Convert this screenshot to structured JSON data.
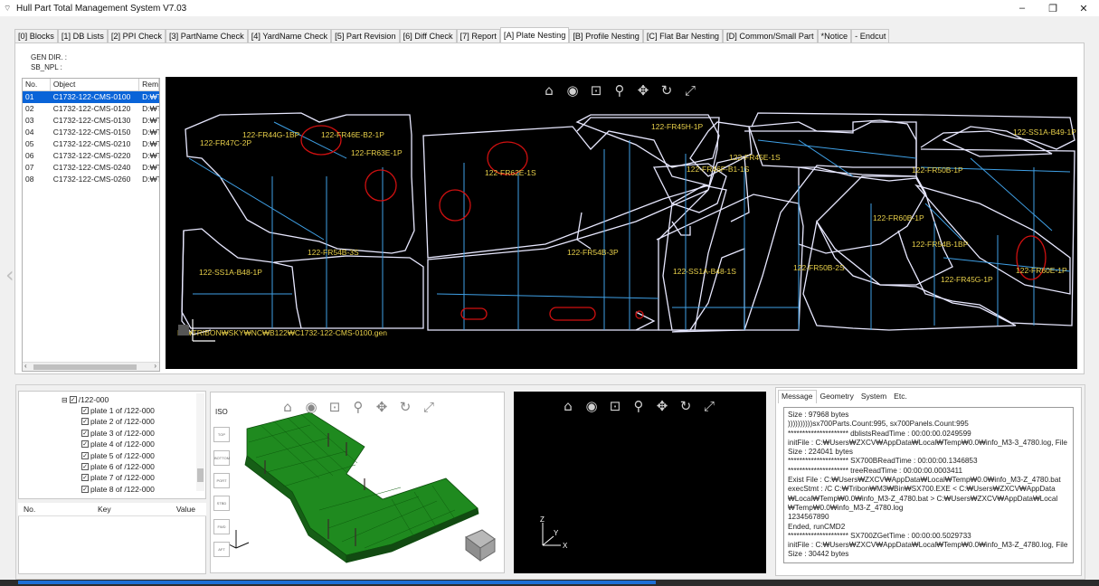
{
  "window": {
    "title": "Hull Part Total Management System V7.03",
    "controls": [
      "–",
      "❐",
      "✕"
    ]
  },
  "tabs": [
    {
      "label": "[0] Blocks"
    },
    {
      "label": "[1] DB Lists"
    },
    {
      "label": "[2] PPI Check"
    },
    {
      "label": "[3] PartName Check"
    },
    {
      "label": "[4] YardName Check"
    },
    {
      "label": "[5] Part Revision"
    },
    {
      "label": "[6] Diff Check"
    },
    {
      "label": "[7] Report"
    },
    {
      "label": "[A] Plate Nesting",
      "active": true
    },
    {
      "label": "[B] Profile Nesting"
    },
    {
      "label": "[C] Flat Bar Nesting"
    },
    {
      "label": "[D] Common/Small Part"
    },
    {
      "label": "*Notice"
    },
    {
      "label": "- Endcut"
    }
  ],
  "info": {
    "gen_dir": "GEN DIR. :",
    "sb_npl": "SB_NPL :"
  },
  "object_list": {
    "columns": [
      "No.",
      "Object",
      "Rema"
    ],
    "rows": [
      {
        "no": "01",
        "object": "C1732-122-CMS-0100",
        "remark": "D:₩T",
        "selected": true
      },
      {
        "no": "02",
        "object": "C1732-122-CMS-0120",
        "remark": "D:₩T"
      },
      {
        "no": "03",
        "object": "C1732-122-CMS-0130",
        "remark": "D:₩T"
      },
      {
        "no": "04",
        "object": "C1732-122-CMS-0150",
        "remark": "D:₩T"
      },
      {
        "no": "05",
        "object": "C1732-122-CMS-0210",
        "remark": "D:₩T"
      },
      {
        "no": "06",
        "object": "C1732-122-CMS-0220",
        "remark": "D:₩T"
      },
      {
        "no": "07",
        "object": "C1732-122-CMS-0240",
        "remark": "D:₩T"
      },
      {
        "no": "08",
        "object": "C1732-122-CMS-0260",
        "remark": "D:₩T"
      }
    ]
  },
  "viewer_toolbar_icons": [
    "home-icon",
    "view-icon",
    "zoom-window-icon",
    "zoom-icon",
    "pan-icon",
    "rotate-icon",
    "fit-icon"
  ],
  "nesting_labels": {
    "l1": "122-FR44G-1BP",
    "l2": "122-FR46E-B2-1P",
    "l3": "122-FR47C-2P",
    "l4": "122-FR63E-1P",
    "l5": "122-FR62E-1S",
    "l6": "122-FR45H-1P",
    "l7": "122-FR46F-B1-1S",
    "l8": "122-FR45E-1S",
    "l9": "122-SS1A-B49-1P",
    "l10": "122-FR50B-1P",
    "l11": "122-FR60B-1P",
    "l12": "122-FR54B-1BP",
    "l13": "122-FR54B-3S",
    "l14": "122-FR54B-3P",
    "l15": "122-SS1A-B48-1P",
    "l16": "122-SS1A-B48-1S",
    "l17": "122-FR50B-2S",
    "l18": "122-FR45G-1P",
    "l19": "122-FR60E-1P",
    "file_path": "D:₩TRIBON₩SKY₩NC₩B122₩C1732-122-CMS-0100.gen"
  },
  "tree": {
    "root": "/122-000",
    "items": [
      "plate 1 of /122-000",
      "plate 2 of /122-000",
      "plate 3 of /122-000",
      "plate 4 of /122-000",
      "plate 5 of /122-000",
      "plate 6 of /122-000",
      "plate 7 of /122-000",
      "plate 8 of /122-000"
    ]
  },
  "properties": {
    "columns": [
      "No.",
      "Key",
      "Value"
    ]
  },
  "view3d": {
    "view_buttons": [
      "ISO",
      "TOP",
      "BOTTOM",
      "PORT",
      "STBD",
      "FWD",
      "AFT"
    ],
    "axis_x": "X",
    "axis_y": "Y",
    "axis_z": "Z"
  },
  "message_panel": {
    "tabs": [
      "Message",
      "Geometry",
      "System",
      "Etc."
    ],
    "lines": [
      "Size : 97968 bytes",
      "))))))))))sx700Parts.Count:995, sx700Panels.Count:995",
      "********************* dblistsReadTime : 00:00:00.0249599",
      "initFile : C:₩Users₩ZXCV₩AppData₩Local₩Temp₩0.0₩info_M3-3_4780.log, File",
      "Size : 224041 bytes",
      "********************* SX700BReadTime : 00:00:00.1346853",
      "********************* treeReadTime : 00:00:00.0003411",
      "Exist File : C:₩Users₩ZXCV₩AppData₩Local₩Temp₩0.0₩info_M3-Z_4780.bat",
      "execStmt :  /C C:₩Tribon₩M3₩Bin₩SX700.EXE < C:₩Users₩ZXCV₩AppData",
      "₩Local₩Temp₩0.0₩info_M3-Z_4780.bat > C:₩Users₩ZXCV₩AppData₩Local",
      "₩Temp₩0.0₩info_M3-Z_4780.log",
      "1234567890",
      "Ended, runCMD2",
      "********************* SX700ZGetTime : 00:00:00.5029733",
      "initFile : C:₩Users₩ZXCV₩AppData₩Local₩Temp₩0.0₩info_M3-Z_4780.log, File",
      "Size : 30442 bytes"
    ]
  },
  "colors": {
    "accent": "#0a64d8",
    "viewer_bg": "#000000",
    "plate_outline": "#e8e8ff",
    "profile_lines": "#3fa0e6",
    "hole_red": "#d01010",
    "label_yellow": "#e8d04a",
    "model_green": "#1f8a1f"
  },
  "progress": {
    "value": 0.58
  }
}
